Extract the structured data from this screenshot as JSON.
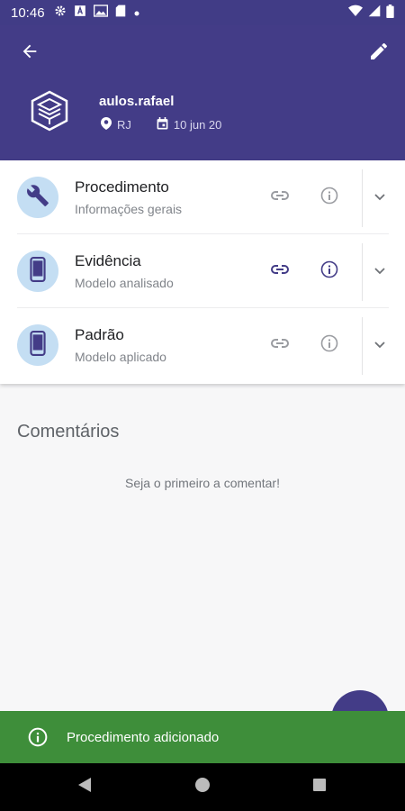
{
  "status_bar": {
    "time": "10:46",
    "left_icons": [
      "gear-icon",
      "font-icon",
      "image-icon",
      "sd-card-icon",
      "dot-icon"
    ],
    "right_icons": [
      "wifi-icon",
      "signal-icon",
      "battery-icon"
    ]
  },
  "header": {
    "username": "aulos.rafael",
    "location": "RJ",
    "date": "10 jun 20",
    "accent_color": "#433c87"
  },
  "items": [
    {
      "title": "Procedimento",
      "subtitle": "Informações gerais",
      "icon": "wrench-icon"
    },
    {
      "title": "Evidência",
      "subtitle": "Modelo analisado",
      "icon": "smartphone-icon"
    },
    {
      "title": "Padrão",
      "subtitle": "Modelo aplicado",
      "icon": "smartphone-icon"
    }
  ],
  "comments": {
    "title": "Comentários",
    "empty_message": "Seja o primeiro a comentar!"
  },
  "snackbar": {
    "message": "Procedimento adicionado",
    "color": "#3e8e3a"
  }
}
